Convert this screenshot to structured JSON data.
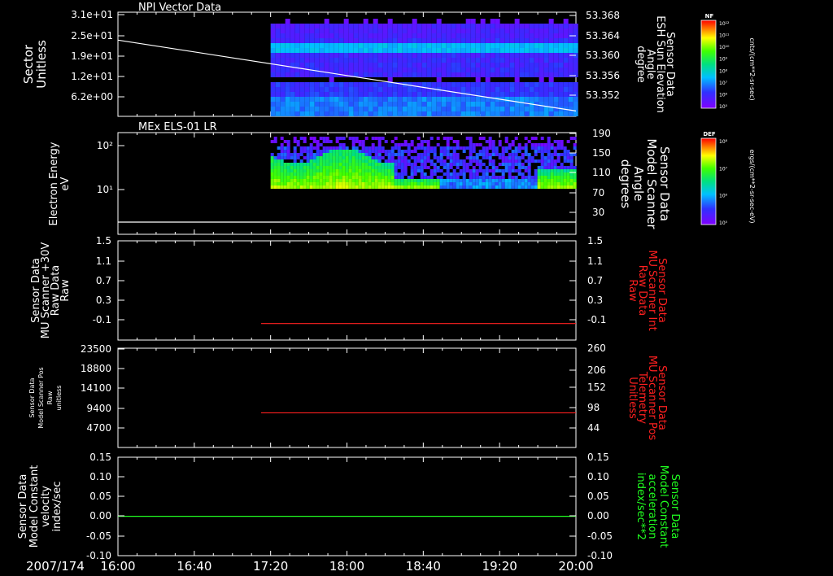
{
  "figure": {
    "date_label": "2007/174",
    "time_ticks": [
      "16:00",
      "16:40",
      "17:20",
      "18:00",
      "18:40",
      "19:20",
      "20:00"
    ]
  },
  "colors": {
    "red": "#ff2020",
    "green": "#20ff20",
    "white": "#ffffff"
  },
  "chart_data": [
    {
      "type": "heatmap",
      "title": "NPI Vector Data",
      "ylabel": [
        "Sector",
        "Unitless"
      ],
      "yticks": [
        "3.1e+01",
        "2.5e+01",
        "1.9e+01",
        "1.2e+01",
        "6.2e+00"
      ],
      "ylabel_right": [
        "Sensor Data",
        "ESH Sun Elevation",
        "Angle",
        "degree"
      ],
      "yticks_right": [
        "53.368",
        "53.364",
        "53.360",
        "53.356",
        "53.352"
      ],
      "xlim": [
        "16:00",
        "20:00"
      ],
      "data_start": "17:20",
      "overlay_line": {
        "x": [
          "16:00",
          "20:00"
        ],
        "y": [
          53.3638,
          53.3506
        ]
      },
      "colorbar": {
        "title": "NF",
        "ticks": [
          "10¹²",
          "10¹¹",
          "10¹⁰",
          "10⁹",
          "10⁸",
          "10⁷",
          "10⁶",
          "10⁵"
        ],
        "unit": "cnts/(cm**2-sr-sec)"
      }
    },
    {
      "type": "heatmap",
      "title": "MEx ELS-01 LR",
      "ylabel": [
        "Electron Energy",
        "eV"
      ],
      "yticks": [
        "10²",
        "10¹"
      ],
      "ylabel_right": [
        "Sensor Data",
        "Model Scanner",
        "Angle",
        "degrees"
      ],
      "yticks_right": [
        "190",
        "150",
        "110",
        "70",
        "30"
      ],
      "xlim": [
        "16:00",
        "20:00"
      ],
      "data_start": "17:20",
      "overlay_line": {
        "x": [
          "16:00",
          "20:00"
        ],
        "y": [
          10,
          10
        ]
      },
      "colorbar": {
        "title": "DEF",
        "ticks": [
          "10⁸",
          "10⁷",
          "10⁶",
          "10⁵"
        ],
        "unit": "ergs/(cm**2-sr-sec-eV)"
      }
    },
    {
      "type": "line",
      "ylabel": [
        "Sensor Data",
        "MU Scanner +30V",
        "Raw Data",
        "Raw"
      ],
      "yticks": [
        "1.5",
        "1.1",
        "0.7",
        "0.3",
        "-0.1"
      ],
      "ylabel_right": [
        "Sensor Data",
        "MU Scanner Int",
        "Raw Data",
        "Raw"
      ],
      "yticks_right": [
        "1.5",
        "1.1",
        "0.7",
        "0.3",
        "-0.1"
      ],
      "ylim": [
        -0.3,
        1.5
      ],
      "series": [
        {
          "x": [
            "17:15",
            "20:00"
          ],
          "y": [
            0.0,
            0.0
          ],
          "color": "#ff2020"
        }
      ]
    },
    {
      "type": "line",
      "ylabel": [
        "Sensor Data",
        "Model Scanner Pos",
        "Raw",
        "unitless"
      ],
      "yticks": [
        "23500",
        "18800",
        "14100",
        "9400",
        "4700"
      ],
      "ylabel_right": [
        "Sensor Data",
        "MU Scanner Pos",
        "Telemetry",
        "Unitless"
      ],
      "yticks_right": [
        "260",
        "206",
        "152",
        "98",
        "44"
      ],
      "ylim": [
        0,
        23500
      ],
      "series": [
        {
          "x": [
            "17:15",
            "20:00"
          ],
          "y": [
            8200,
            8200
          ],
          "color": "#ff2020"
        }
      ]
    },
    {
      "type": "line",
      "ylabel": [
        "Sensor Data",
        "Model Constant",
        "velocity",
        "index/sec"
      ],
      "yticks": [
        "0.15",
        "0.10",
        "0.05",
        "0.00",
        "-0.05",
        "-0.10"
      ],
      "ylabel_right": [
        "Sensor Data",
        "Model Constant",
        "acceleration",
        "index/sec**2"
      ],
      "yticks_right": [
        "0.15",
        "0.10",
        "0.05",
        "0.00",
        "-0.05",
        "-0.10"
      ],
      "ylim": [
        -0.1,
        0.15
      ],
      "series": [
        {
          "x": [
            "16:00",
            "20:00"
          ],
          "y": [
            0.0,
            0.0
          ],
          "color": "#20ff20"
        }
      ]
    }
  ]
}
